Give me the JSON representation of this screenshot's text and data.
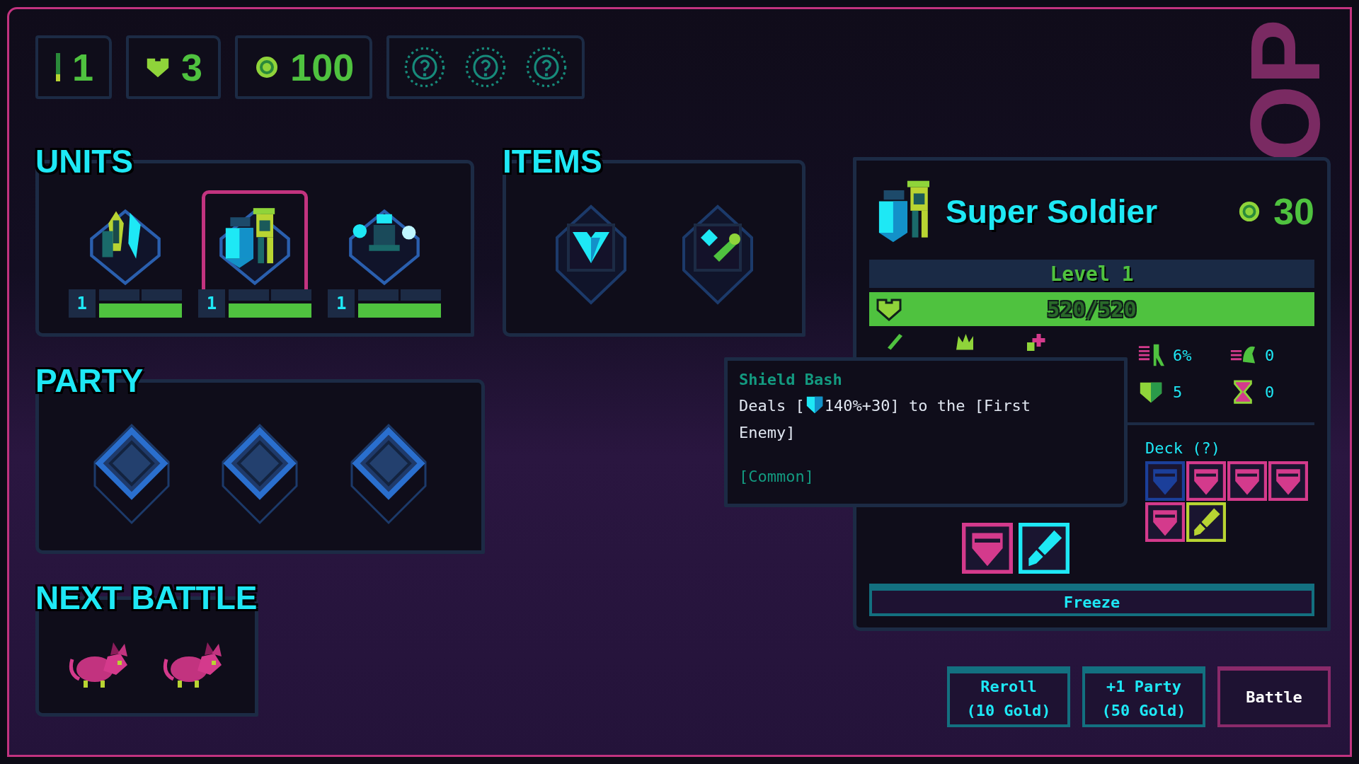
{
  "top_bar": {
    "round": "1",
    "lives": "3",
    "gold": "100",
    "relic_slots": [
      {
        "kind": "unknown"
      },
      {
        "kind": "unknown"
      },
      {
        "kind": "unknown"
      }
    ]
  },
  "background_text": "OP",
  "units": {
    "title": "UNITS",
    "items": [
      {
        "kind": "crystal",
        "level": "1",
        "health": {
          "level": 1
        },
        "selected": false
      },
      {
        "kind": "soldier",
        "level": "1",
        "health": {
          "level": 1
        },
        "selected": true
      },
      {
        "kind": "spirit",
        "level": "1",
        "health": {
          "level": 1
        },
        "selected": false
      }
    ]
  },
  "items": {
    "title": "ITEMS",
    "items": [
      {
        "kind": "heart-shield"
      },
      {
        "kind": "potion"
      }
    ]
  },
  "party": {
    "title": "PARTY",
    "slots": [
      {
        "kind": "empty"
      },
      {
        "kind": "empty"
      },
      {
        "kind": "empty"
      }
    ]
  },
  "next_battle": {
    "title": "NEXT BATTLE",
    "enemies": [
      {
        "kind": "rat"
      },
      {
        "kind": "rat"
      }
    ]
  },
  "detail": {
    "kind": "soldier",
    "name": "Super Soldier",
    "cost": "30",
    "level_label": "Level 1",
    "hp": "520/520",
    "hp_bar": {
      "level": 1
    },
    "covered_stats": [
      {
        "kind": "attack"
      },
      {
        "kind": "fury"
      },
      {
        "kind": "heal"
      }
    ],
    "stats": [
      {
        "kind": "crit",
        "value": "6%"
      },
      {
        "kind": "speed",
        "value": "0"
      },
      {
        "kind": "armor",
        "value": "5"
      },
      {
        "kind": "time",
        "value": "0"
      }
    ],
    "skills": [
      {
        "kind": "shield",
        "color": "#d43a8c"
      },
      {
        "kind": "sword",
        "color": "#1ee8f5"
      }
    ],
    "deck_label": "Deck (?)",
    "deck": [
      {
        "kind": "shield",
        "color": "#1b3f9a"
      },
      {
        "kind": "shield",
        "color": "#d43a8c"
      },
      {
        "kind": "shield",
        "color": "#d43a8c"
      },
      {
        "kind": "shield",
        "color": "#d43a8c"
      },
      {
        "kind": "shield",
        "color": "#d43a8c"
      },
      {
        "kind": "sword",
        "color": "#b8d432"
      }
    ],
    "freeze_button": "Freeze"
  },
  "tooltip": {
    "title": "Shield Bash",
    "text_before": "Deals [",
    "text_after": "140%+30] to the [First Enemy]",
    "rarity": "[Common]"
  },
  "buttons": [
    {
      "kind": "shop",
      "label": "Reroll (10 Gold)"
    },
    {
      "kind": "shop",
      "label": "+1 Party (50 Gold)"
    },
    {
      "kind": "primary",
      "label": "Battle"
    }
  ]
}
